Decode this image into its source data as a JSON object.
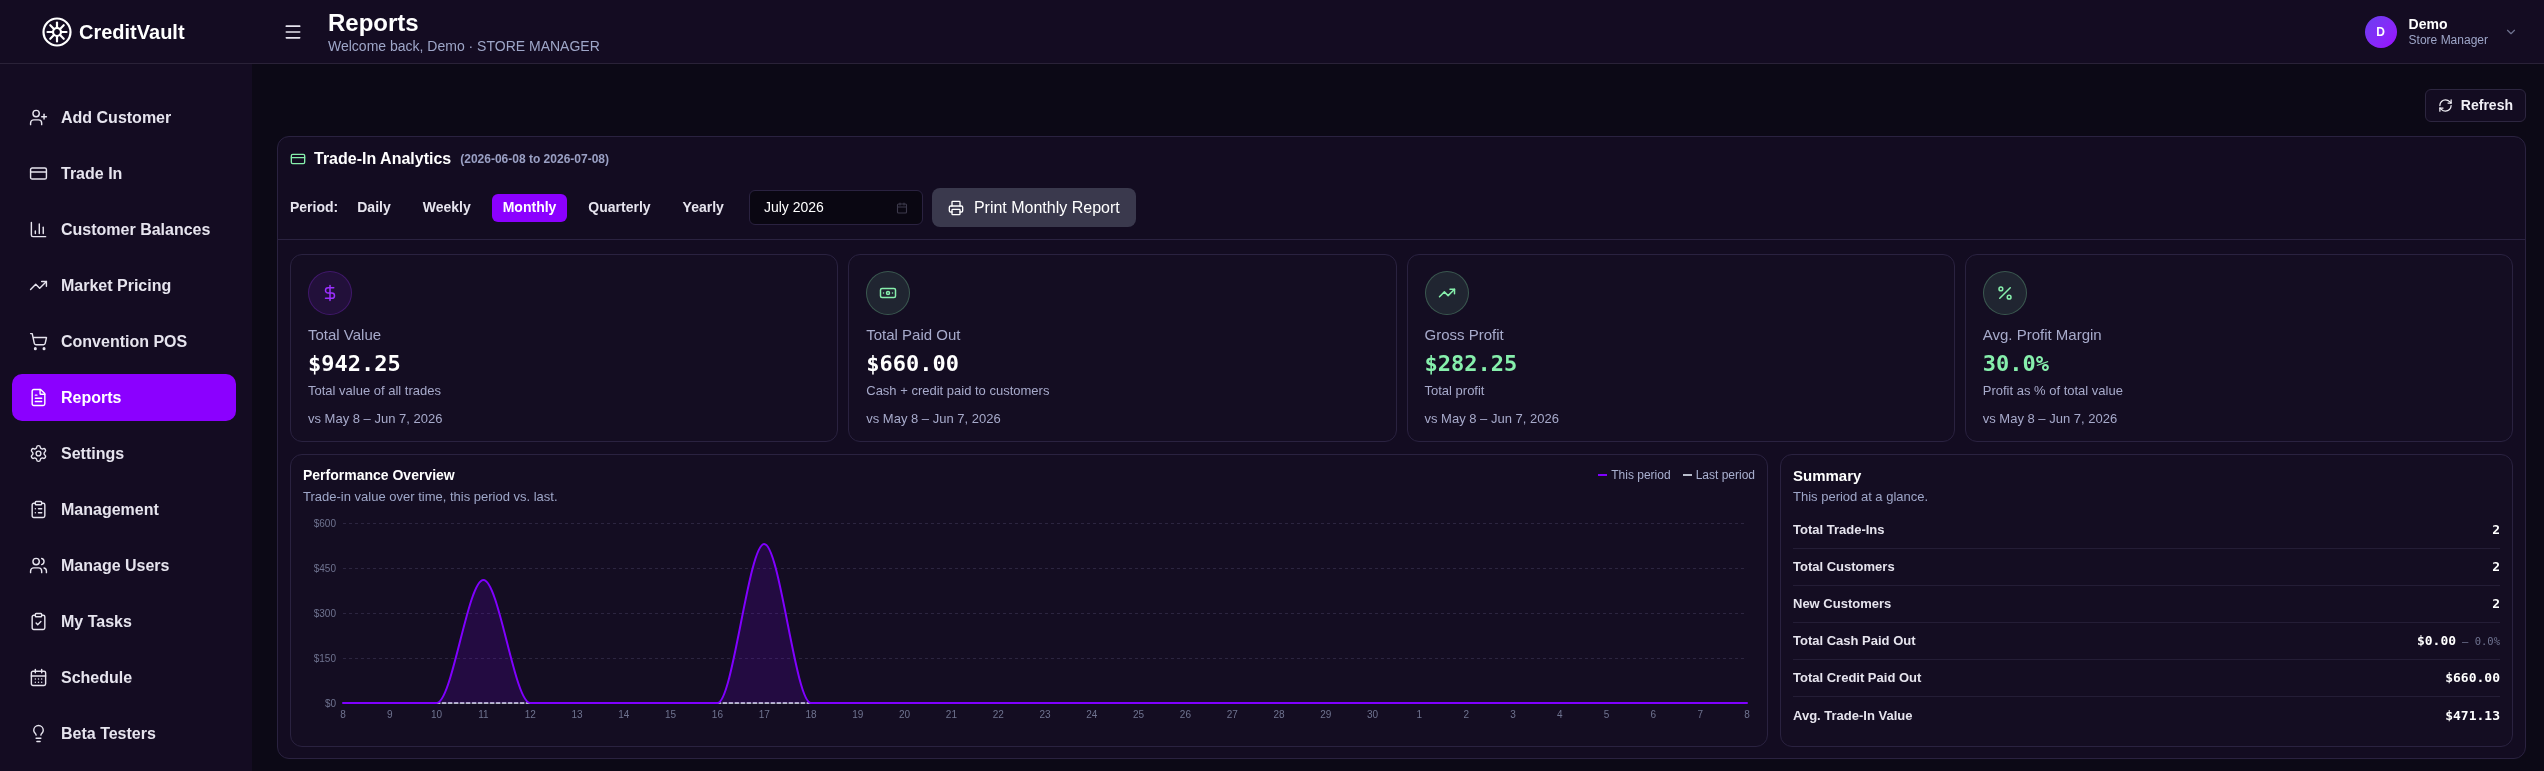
{
  "app": {
    "name": "CreditVault"
  },
  "header": {
    "title": "Reports",
    "subtitle": "Welcome back, Demo · STORE MANAGER",
    "user": {
      "initial": "D",
      "name": "Demo",
      "role": "Store Manager"
    }
  },
  "sidebar": {
    "items": [
      {
        "label": "Add Customer",
        "selected": false
      },
      {
        "label": "Trade In",
        "selected": false
      },
      {
        "label": "Customer Balances",
        "selected": false
      },
      {
        "label": "Market Pricing",
        "selected": false
      },
      {
        "label": "Convention POS",
        "selected": false
      },
      {
        "label": "Reports",
        "selected": true
      },
      {
        "label": "Settings",
        "selected": false
      },
      {
        "label": "Management",
        "selected": false
      },
      {
        "label": "Manage Users",
        "selected": false
      },
      {
        "label": "My Tasks",
        "selected": false
      },
      {
        "label": "Schedule",
        "selected": false
      },
      {
        "label": "Beta Testers",
        "selected": false
      }
    ]
  },
  "toolbar": {
    "refresh": "Refresh"
  },
  "analytics": {
    "title": "Trade-In Analytics",
    "range": "(2026-06-08 to 2026-07-08)",
    "period_label": "Period:",
    "periods": [
      {
        "label": "Daily",
        "selected": false
      },
      {
        "label": "Weekly",
        "selected": false
      },
      {
        "label": "Monthly",
        "selected": true
      },
      {
        "label": "Quarterly",
        "selected": false
      },
      {
        "label": "Yearly",
        "selected": false
      }
    ],
    "month": {
      "value": "July 2026"
    },
    "print_button": "Print Monthly Report",
    "stats": [
      {
        "label": "Total Value",
        "value": "$942.25",
        "description": "Total value of all trades",
        "comparison": "vs May 8 – Jun 7, 2026",
        "color": "#9b30ff",
        "positive": false
      },
      {
        "label": "Total Paid Out",
        "value": "$660.00",
        "description": "Cash + credit paid to customers",
        "comparison": "vs May 8 – Jun 7, 2026",
        "color": "#86efac",
        "positive": false
      },
      {
        "label": "Gross Profit",
        "value": "$282.25",
        "description": "Total profit",
        "comparison": "vs May 8 – Jun 7, 2026",
        "color": "#86efac",
        "positive": true
      },
      {
        "label": "Avg. Profit Margin",
        "value": "30.0%",
        "description": "Profit as % of total value",
        "comparison": "vs May 8 – Jun 7, 2026",
        "color": "#86efac",
        "positive": true
      }
    ],
    "performance": {
      "subtitle": "Trade-in value over time, this period vs. last.",
      "chart_data": {
        "type": "line",
        "title": "Performance Overview",
        "grid": true,
        "categories": [
          "8",
          "9",
          "10",
          "11",
          "12",
          "13",
          "14",
          "15",
          "16",
          "17",
          "18",
          "19",
          "20",
          "21",
          "22",
          "23",
          "24",
          "25",
          "26",
          "27",
          "28",
          "29",
          "30",
          "1",
          "2",
          "3",
          "4",
          "5",
          "6",
          "7",
          "8"
        ],
        "series": [
          {
            "name": "This period",
            "color": "#8000ff",
            "line_style": "solid",
            "values": [
              0,
              0,
              0,
              410,
              0,
              0,
              0,
              0,
              0,
              530,
              0,
              0,
              0,
              0,
              0,
              0,
              0,
              0,
              0,
              0,
              0,
              0,
              0,
              0,
              0,
              0,
              0,
              0,
              0,
              0,
              0
            ]
          },
          {
            "name": "Last period",
            "color": "#b8bccb",
            "line_style": "dashed",
            "values": [
              null,
              null,
              0,
              0,
              0,
              null,
              null,
              null,
              0,
              0,
              0,
              null,
              null,
              null,
              null,
              null,
              null,
              null,
              null,
              null,
              null,
              null,
              null,
              null,
              null,
              null,
              null,
              null,
              null,
              null,
              null
            ]
          }
        ],
        "ylim": [
          0,
          600
        ],
        "yticks": [
          {
            "value": 0,
            "label": "$0"
          },
          {
            "value": 150,
            "label": "$150"
          },
          {
            "value": 300,
            "label": "$300"
          },
          {
            "value": 450,
            "label": "$450"
          },
          {
            "value": 600,
            "label": "$600"
          }
        ]
      }
    },
    "summary": {
      "title": "Summary",
      "subtitle": "This period at a glance.",
      "rows": [
        {
          "label": "Total Trade-Ins",
          "value": "2"
        },
        {
          "label": "Total Customers",
          "value": "2"
        },
        {
          "label": "New Customers",
          "value": "2"
        },
        {
          "label": "Total Cash Paid Out",
          "value": "$0.00",
          "change": "— 0.0%"
        },
        {
          "label": "Total Credit Paid Out",
          "value": "$660.00"
        },
        {
          "label": "Avg. Trade-In Value",
          "value": "$471.13"
        }
      ]
    }
  }
}
